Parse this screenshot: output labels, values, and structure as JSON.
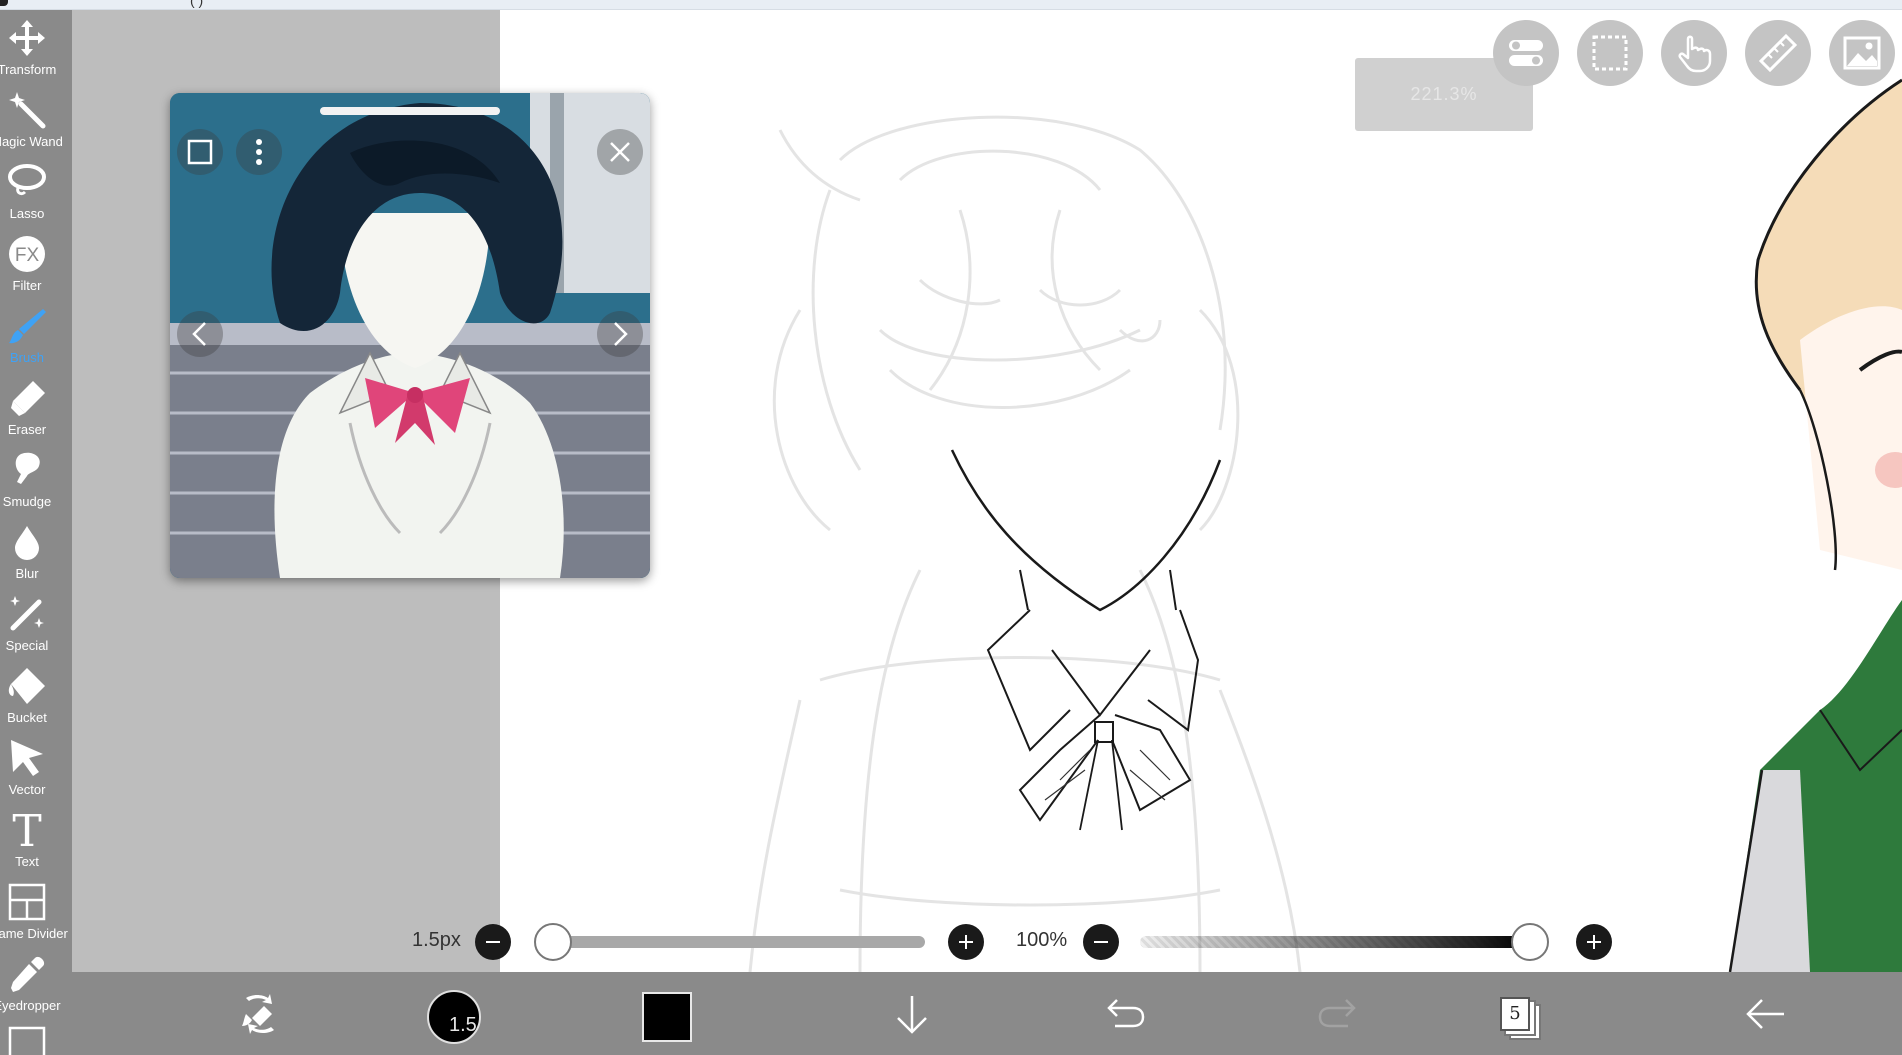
{
  "window": {
    "title": "(               )"
  },
  "tools": [
    {
      "id": "transform",
      "label": "Transform",
      "icon": "move-arrows-icon"
    },
    {
      "id": "magic-wand",
      "label": "Magic Wand",
      "icon": "magic-wand-icon"
    },
    {
      "id": "lasso",
      "label": "Lasso",
      "icon": "lasso-icon"
    },
    {
      "id": "filter",
      "label": "Filter",
      "icon": "fx-icon"
    },
    {
      "id": "brush",
      "label": "Brush",
      "icon": "brush-icon",
      "active": true
    },
    {
      "id": "eraser",
      "label": "Eraser",
      "icon": "eraser-icon"
    },
    {
      "id": "smudge",
      "label": "Smudge",
      "icon": "smudge-icon"
    },
    {
      "id": "blur",
      "label": "Blur",
      "icon": "drop-icon"
    },
    {
      "id": "special",
      "label": "Special",
      "icon": "sparkle-wand-icon"
    },
    {
      "id": "bucket",
      "label": "Bucket",
      "icon": "bucket-icon"
    },
    {
      "id": "vector",
      "label": "Vector",
      "icon": "cursor-arrow-icon"
    },
    {
      "id": "text",
      "label": "Text",
      "icon": "text-t-icon"
    },
    {
      "id": "frame-divider",
      "label": "Frame Divider",
      "icon": "frame-divider-icon"
    },
    {
      "id": "eyedropper",
      "label": "Eyedropper",
      "icon": "eyedropper-icon"
    }
  ],
  "canvas": {
    "zoom_readout": "221.3%"
  },
  "top_buttons": [
    {
      "id": "toggles",
      "icon": "toggle-switches-icon"
    },
    {
      "id": "selection",
      "icon": "dotted-selection-icon"
    },
    {
      "id": "hand",
      "icon": "hand-pointer-icon"
    },
    {
      "id": "ruler",
      "icon": "ruler-icon"
    },
    {
      "id": "reference",
      "icon": "image-icon"
    }
  ],
  "reference_window": {
    "buttons": [
      "square-frame-icon",
      "more-vertical-icon",
      "close-icon",
      "chevron-left-icon",
      "chevron-right-icon"
    ]
  },
  "brush_controls": {
    "size_label": "1.5px",
    "size_fraction": 0.04,
    "opacity_label": "100%",
    "opacity_fraction": 1.0
  },
  "bottom_bar": {
    "brush_size_value": "1.5",
    "color": "#000000",
    "layer_count": "5",
    "accent": "#3fa2f5"
  }
}
